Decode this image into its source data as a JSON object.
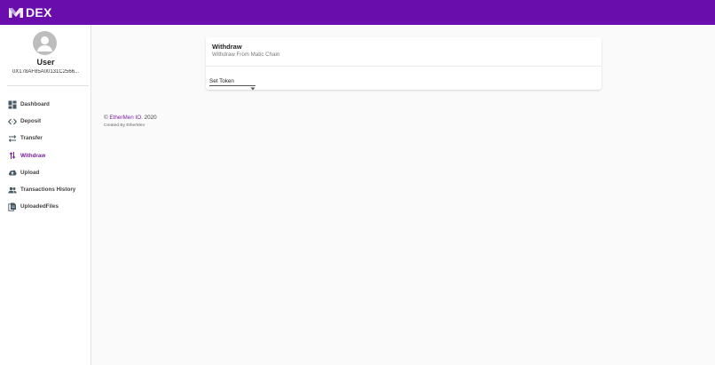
{
  "brand": {
    "name": "DEX",
    "color": "#6a0dad",
    "logo_icon": "m-logo-icon"
  },
  "user": {
    "name": "User",
    "address": "0X178AF85A00131C2566..."
  },
  "nav": {
    "items": [
      {
        "label": "Dashboard",
        "icon": "dashboard-icon",
        "active": false
      },
      {
        "label": "Deposit",
        "icon": "code-arrows-icon",
        "active": false
      },
      {
        "label": "Transfer",
        "icon": "swap-arrows-icon",
        "active": false
      },
      {
        "label": "Withdraw",
        "icon": "withdraw-arrows-icon",
        "active": true
      },
      {
        "label": "Upload",
        "icon": "cloud-upload-icon",
        "active": false
      },
      {
        "label": "Transactions History",
        "icon": "people-icon",
        "active": false
      },
      {
        "label": "UploadedFiles",
        "icon": "files-icon",
        "active": false
      }
    ],
    "active_color": "#7b1fa2"
  },
  "card": {
    "title": "Withdraw",
    "subtitle": "Withdraw From Matic Chain",
    "token_select": {
      "value": "Set Token"
    }
  },
  "footer": {
    "copyright_prefix": "© ",
    "link_text": "EtherMen IO.",
    "year": " 2020",
    "credit": "Created By EtherMen"
  }
}
